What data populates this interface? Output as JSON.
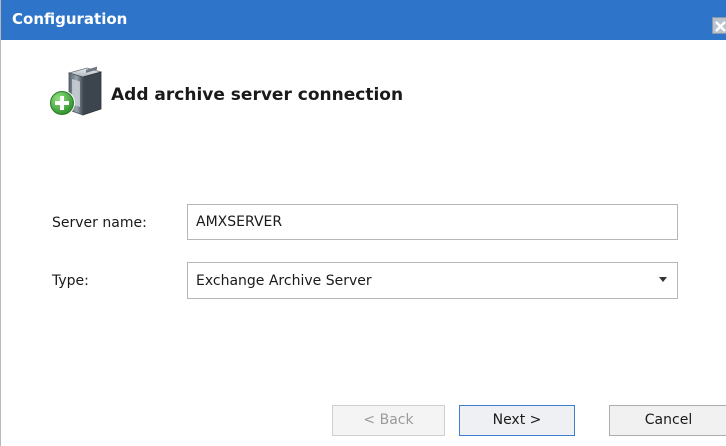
{
  "window": {
    "title": "Configuration",
    "close_symbol": "×"
  },
  "header": {
    "title": "Add archive server connection",
    "icon": "server-add-icon"
  },
  "form": {
    "server_name_label": "Server name:",
    "server_name_value": "AMXSERVER",
    "type_label": "Type:",
    "type_value": "Exchange Archive Server"
  },
  "buttons": {
    "back": "< Back",
    "next": "Next >",
    "cancel": "Cancel"
  },
  "colors": {
    "titlebar": "#2e75c9",
    "add_badge": "#3fae3a"
  }
}
